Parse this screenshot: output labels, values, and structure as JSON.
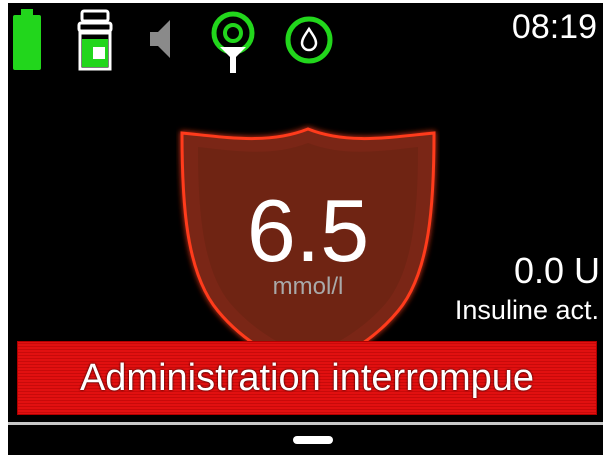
{
  "status_bar": {
    "time": "08:19",
    "icons": [
      "battery-icon",
      "insulin-cartridge-icon",
      "speaker-muted-icon",
      "cgm-sensor-icon",
      "drop-icon"
    ]
  },
  "glucose": {
    "value": "6.5",
    "unit": "mmol/l"
  },
  "insulin": {
    "value": "0.0 U",
    "label": "Insuline act."
  },
  "alert": {
    "message": "Administration interrompue"
  },
  "colors": {
    "status_green": "#22d61c",
    "shield_fill": "#7a2815",
    "shield_border": "#ff3a1a",
    "alert_red": "#e11010"
  }
}
